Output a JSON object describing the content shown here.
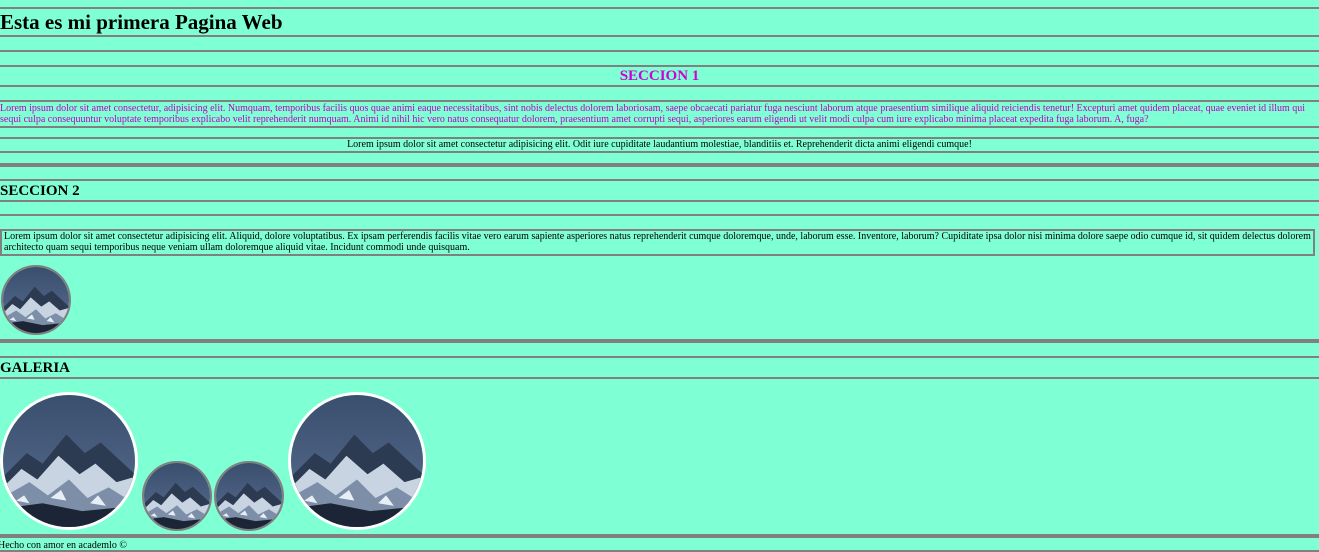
{
  "header": {
    "title": "Esta es mi primera Pagina Web"
  },
  "seccion1": {
    "title": "SECCION 1",
    "paragraph_colored": "Lorem ipsum dolor sit amet consectetur, adipisicing elit. Numquam, temporibus facilis quos quae animi eaque necessitatibus, sint nobis delectus dolorem laboriosam, saepe obcaecati pariatur fuga nesciunt laborum atque praesentium similique aliquid reiciendis tenetur! Excepturi amet quidem placeat, quae eveniet id illum qui sequi culpa consequuntur voluptate temporibus explicabo velit reprehenderit numquam. Animi id nihil hic vero natus consequatur dolorem, praesentium amet corrupti sequi, asperiores earum eligendi ut velit modi culpa cum iure explicabo minima placeat expedita fuga laborum. A, fuga?",
    "paragraph_centered": "Lorem ipsum dolor sit amet consectetur adipisicing elit. Odit iure cupiditate laudantium molestiae, blanditiis et. Reprehenderit dicta animi eligendi cumque!"
  },
  "seccion2": {
    "title": "SECCION 2",
    "paragraph": "Lorem ipsum dolor sit amet consectetur adipisicing elit. Aliquid, dolore voluptatibus. Ex ipsam perferendis facilis vitae vero earum sapiente asperiores natus reprehenderit cumque doloremque, unde, laborum esse. Inventore, laborum? Cupiditate ipsa dolor nisi minima dolore saepe odio cumque id, sit quidem delectus dolorem architecto quam sequi temporibus neque veniam ullam doloremque aliquid vitae. Incidunt commodi unde quisquam."
  },
  "galeria": {
    "title": "GALERIA"
  },
  "footer": {
    "text": "Hecho con amor en academlo ©"
  },
  "colors": {
    "background": "#7fffd4",
    "rule": "#808080",
    "magenta_heading": "#d100d1",
    "magenta_text": "#c000c0"
  }
}
